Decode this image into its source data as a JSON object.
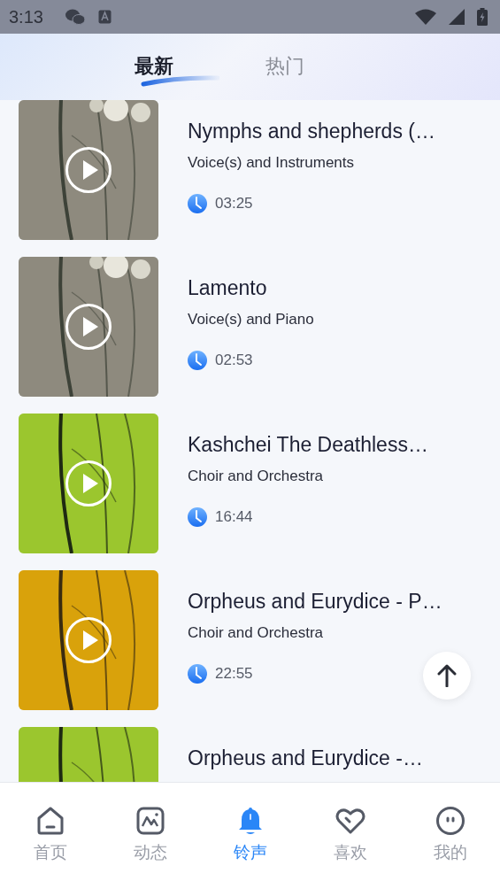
{
  "status_bar": {
    "time": "3:13"
  },
  "tabs": [
    {
      "label": "最新",
      "selected": true
    },
    {
      "label": "热门",
      "selected": false
    }
  ],
  "tracks": [
    {
      "title": "Nymphs and shepherds (…",
      "subtitle": "Voice(s) and Instruments",
      "duration": "03:25"
    },
    {
      "title": "Lamento",
      "subtitle": "Voice(s) and Piano",
      "duration": "02:53"
    },
    {
      "title": "Kashchei The Deathless…",
      "subtitle": "Choir and Orchestra",
      "duration": "16:44"
    },
    {
      "title": "Orpheus and Eurydice - P…",
      "subtitle": "Choir and Orchestra",
      "duration": "22:55"
    },
    {
      "title": "Orpheus and Eurydice -…"
    }
  ],
  "bottom_nav": [
    {
      "label": "首页",
      "selected": false
    },
    {
      "label": "动态",
      "selected": false
    },
    {
      "label": "铃声",
      "selected": true
    },
    {
      "label": "喜欢",
      "selected": false
    },
    {
      "label": "我的",
      "selected": false
    }
  ]
}
